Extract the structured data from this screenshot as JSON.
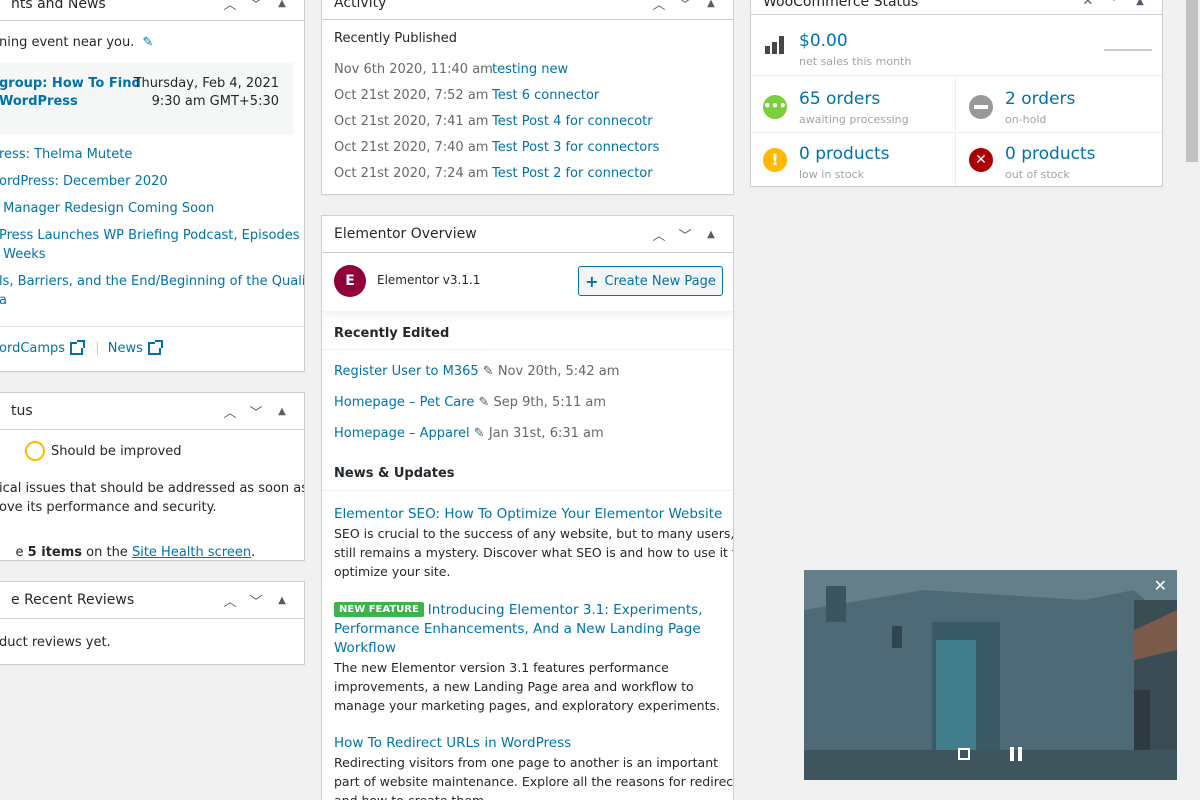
{
  "events": {
    "title": "nts and News",
    "intro": "ning event near you.",
    "meetup": {
      "title_line1": "group: How To Find",
      "title_line2": "WordPress",
      "date": "Thursday, Feb 4, 2021",
      "time": "9:30 am GMT+5:30"
    },
    "news": [
      "ress: Thelma Mutete",
      "ordPress: December 2020",
      " Manager Redesign Coming Soon",
      "Press Launches WP Briefing Podcast, Episodes",
      " Weeks",
      "ls, Barriers, and the End/Beginning of the Quality",
      "a"
    ],
    "footer_wordcamps": "ordCamps",
    "footer_sep": "|",
    "footer_news": "News"
  },
  "site_health": {
    "title": "tus",
    "status": "Should be improved",
    "desc_line1": "ical issues that should be addressed as soon as",
    "desc_line2": "ove its performance and security.",
    "items_prefix": "e ",
    "items_bold": "5 items",
    "items_mid": " on the ",
    "items_link": "Site Health screen",
    "items_end": "."
  },
  "reviews": {
    "title": "e Recent Reviews",
    "empty": "duct reviews yet."
  },
  "activity": {
    "title": "Activity",
    "subtitle": "Recently Published",
    "items": [
      {
        "date": "Nov 6th 2020, 11:40 am",
        "title": "testing new"
      },
      {
        "date": "Oct 21st 2020, 7:52 am",
        "title": "Test 6 connector"
      },
      {
        "date": "Oct 21st 2020, 7:41 am",
        "title": "Test Post 4 for connecotr"
      },
      {
        "date": "Oct 21st 2020, 7:40 am",
        "title": "Test Post 3 for connectors"
      },
      {
        "date": "Oct 21st 2020, 7:24 am",
        "title": "Test Post 2 for connector"
      }
    ]
  },
  "elementor": {
    "title": "Elementor Overview",
    "version": "Elementor v3.1.1",
    "create_button": "Create New Page",
    "recently_edited": "Recently Edited",
    "edited": [
      {
        "title": "Register User to M365",
        "date": "Nov 20th, 5:42 am"
      },
      {
        "title": "Homepage – Pet Care",
        "date": "Sep 9th, 5:11 am"
      },
      {
        "title": "Homepage – Apparel",
        "date": "Jan 31st, 6:31 am"
      }
    ],
    "news_heading": "News & Updates",
    "news": [
      {
        "title": "Elementor SEO: How To Optimize Your Elementor Website",
        "badge": "",
        "lines": [
          "SEO is crucial to the success of any website, but to many users, it",
          "still remains a mystery. Discover what SEO is and how to use it to",
          "optimize your site."
        ]
      },
      {
        "title_lines": [
          "Introducing Elementor 3.1: Experiments,",
          "Performance Enhancements, And a New Landing Page",
          "Workflow"
        ],
        "badge": "NEW FEATURE",
        "lines": [
          "The new Elementor version 3.1 features performance",
          "improvements, a new Landing Page area and workflow to",
          "manage your marketing pages, and exploratory experiments."
        ]
      },
      {
        "title": "How To Redirect URLs in WordPress",
        "badge": "",
        "lines": [
          "Redirecting visitors from one page to another is an important",
          "part of website maintenance. Explore all the reasons for redirects",
          "and how to create them."
        ]
      }
    ]
  },
  "woocommerce": {
    "title": "WooCommerce Status",
    "sales_value": "$0.00",
    "sales_label": "net sales this month",
    "cells": [
      {
        "value": "65 orders",
        "label": "awaiting processing",
        "color": "#7ad03a",
        "icon": "more-icon"
      },
      {
        "value": "2 orders",
        "label": "on-hold",
        "color": "#999999",
        "icon": "minus-icon"
      },
      {
        "value": "0 products",
        "label": "low in stock",
        "color": "#ffba00",
        "icon": "warning-icon"
      },
      {
        "value": "0 products",
        "label": "out of stock",
        "color": "#aa0000",
        "icon": "close-icon"
      }
    ]
  },
  "colors": {
    "link": "#0073aa",
    "badge": "#39b54a",
    "elementor": "#92003b"
  }
}
